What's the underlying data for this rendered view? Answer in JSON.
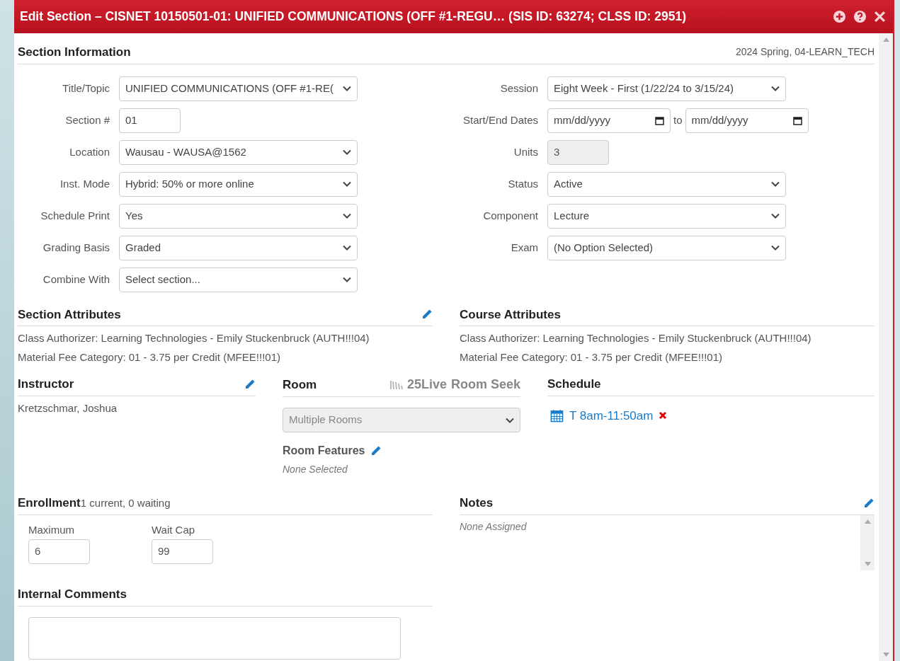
{
  "window": {
    "title": "Edit Section – CISNET 10150501-01: UNIFIED COMMUNICATIONS (OFF #1-REGU… (SIS ID: 63274; CLSS ID: 2951)"
  },
  "section_info": {
    "heading": "Section Information",
    "term": "2024 Spring, 04-LEARN_TECH",
    "left_fields": [
      {
        "label": "Title/Topic",
        "kind": "select",
        "value": "UNIFIED COMMUNICATIONS (OFF #1-RE("
      },
      {
        "label": "Section #",
        "kind": "text",
        "value": "01"
      },
      {
        "label": "Location",
        "kind": "select",
        "value": "Wausau - WAUSA@1562"
      },
      {
        "label": "Inst. Mode",
        "kind": "select",
        "value": "Hybrid: 50% or more online"
      },
      {
        "label": "Schedule Print",
        "kind": "select",
        "value": "Yes"
      },
      {
        "label": "Grading Basis",
        "kind": "select",
        "value": "Graded"
      },
      {
        "label": "Combine With",
        "kind": "select",
        "value": "Select section..."
      }
    ],
    "right_fields": [
      {
        "label": "Session",
        "kind": "select",
        "value": "Eight Week - First (1/22/24 to 3/15/24)"
      },
      {
        "label": "Start/End Dates",
        "kind": "date_range",
        "start_placeholder": "mm/dd/yyyy",
        "separator": "to",
        "end_placeholder": "mm/dd/yyyy"
      },
      {
        "label": "Units",
        "kind": "readonly",
        "value": "3"
      },
      {
        "label": "Status",
        "kind": "select",
        "value": "Active"
      },
      {
        "label": "Component",
        "kind": "select",
        "value": "Lecture"
      },
      {
        "label": "Exam",
        "kind": "select",
        "value": "(No Option Selected)"
      }
    ]
  },
  "section_attributes": {
    "heading": "Section Attributes",
    "lines": [
      "Class Authorizer: Learning Technologies - Emily Stuckenbruck (AUTH!!!04)",
      "Material Fee Category: 01 - 3.75 per Credit (MFEE!!!01)"
    ]
  },
  "course_attributes": {
    "heading": "Course Attributes",
    "lines": [
      "Class Authorizer: Learning Technologies - Emily Stuckenbruck (AUTH!!!04)",
      "Material Fee Category: 01 - 3.75 per Credit (MFEE!!!01)"
    ]
  },
  "instructor": {
    "heading": "Instructor",
    "names": [
      "Kretzschmar, Joshua"
    ]
  },
  "room": {
    "heading": "Room",
    "logo_text": "25Live",
    "logo_suffix": "Room Seek",
    "select": {
      "value": "Multiple Rooms",
      "disabled": true
    },
    "features_heading": "Room Features",
    "features_value": "None Selected"
  },
  "schedule": {
    "heading": "Schedule",
    "entries": [
      "T 8am-11:50am"
    ]
  },
  "enrollment": {
    "heading": "Enrollment",
    "summary": "1 current, 0 waiting",
    "fields": [
      {
        "label": "Maximum",
        "value": "6"
      },
      {
        "label": "Wait Cap",
        "value": "99"
      }
    ]
  },
  "notes": {
    "heading": "Notes",
    "value": "None Assigned"
  },
  "internal_comments": {
    "heading": "Internal Comments"
  }
}
